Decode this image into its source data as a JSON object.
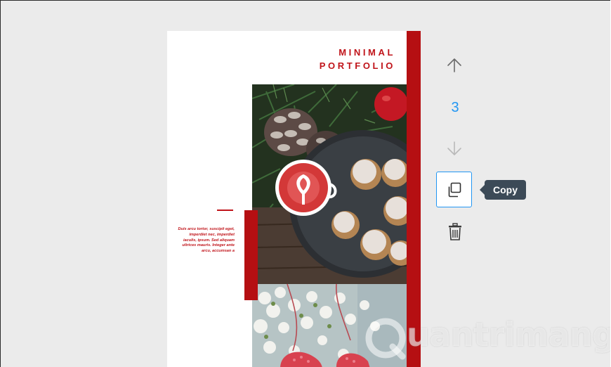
{
  "document": {
    "title_line1": "MINIMAL",
    "title_line2": "PORTFOLIO",
    "caption": "Duis arcu tortor, suscipit eget, imperdiet nec, imperdiet iaculis, ipsum. Sed aliquam ultrices mauris. Integer ante arcu, accumsan a"
  },
  "controls": {
    "move_up_icon": "arrow-up-icon",
    "page_number": "3",
    "move_down_icon": "arrow-down-icon",
    "copy_icon": "copy-icon",
    "copy_tooltip": "Copy",
    "delete_icon": "trash-icon"
  },
  "watermark": {
    "text": "uantrimang"
  },
  "colors": {
    "background": "#ebebeb",
    "accent_red": "#b50f12",
    "accent_blue": "#2196f3",
    "tooltip_bg": "#3c4a57",
    "icon_gray": "#6b6b6b"
  }
}
